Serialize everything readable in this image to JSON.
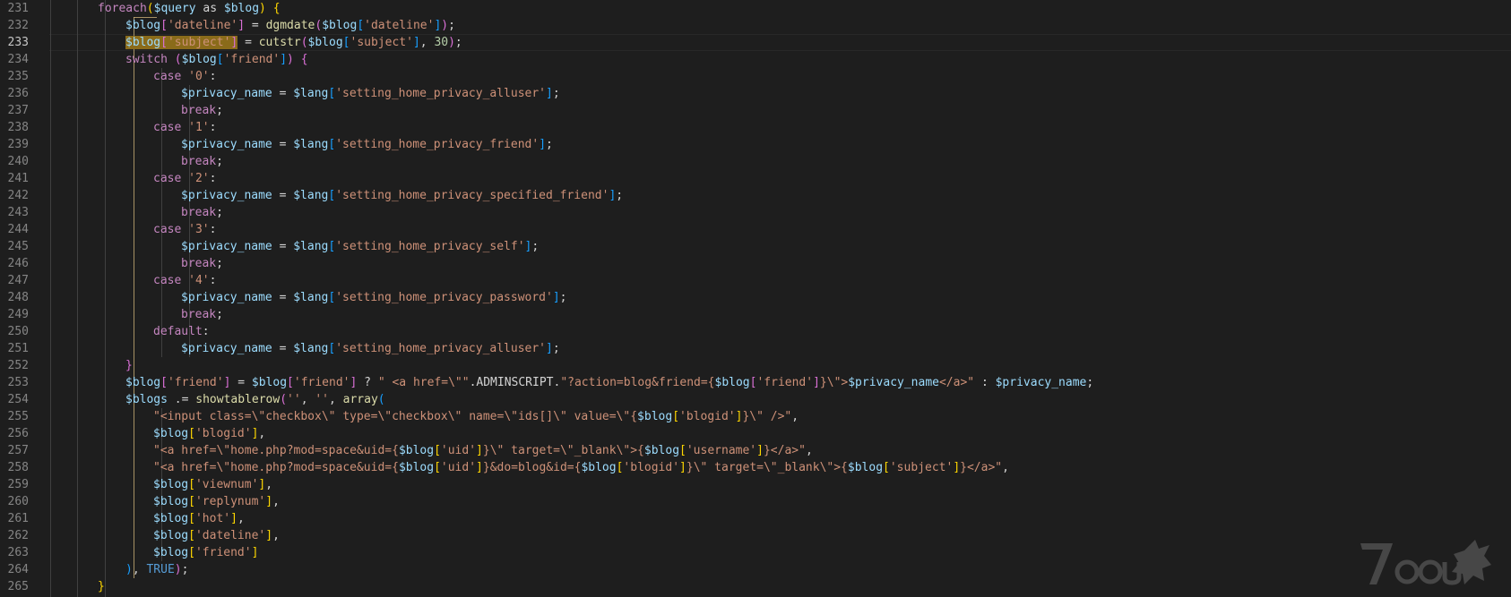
{
  "editor": {
    "current_line": "233",
    "line_numbers": [
      "231",
      "232",
      "233",
      "234",
      "235",
      "236",
      "237",
      "238",
      "239",
      "240",
      "241",
      "242",
      "243",
      "244",
      "245",
      "246",
      "247",
      "248",
      "249",
      "250",
      "251",
      "252",
      "253",
      "254",
      "255",
      "256",
      "257",
      "258",
      "259",
      "260",
      "261",
      "262",
      "263",
      "264",
      "265"
    ]
  },
  "code": [
    [
      [
        "k",
        "foreach"
      ],
      [
        "b1",
        "("
      ],
      [
        "v",
        "$query"
      ],
      [
        "p",
        " as "
      ],
      [
        "v",
        "$blog"
      ],
      [
        "b1",
        ")"
      ],
      [
        "p",
        " "
      ],
      [
        "b1",
        "{"
      ]
    ],
    [
      [
        "v",
        "$blog"
      ],
      [
        "b2",
        "["
      ],
      [
        "s",
        "'dateline'"
      ],
      [
        "b2",
        "]"
      ],
      [
        "p",
        " = "
      ],
      [
        "f",
        "dgmdate"
      ],
      [
        "b2",
        "("
      ],
      [
        "v",
        "$blog"
      ],
      [
        "b3",
        "["
      ],
      [
        "s",
        "'dateline'"
      ],
      [
        "b3",
        "]"
      ],
      [
        "b2",
        ")"
      ],
      [
        "p",
        ";"
      ]
    ],
    [
      [
        "hl:v",
        "$blog"
      ],
      [
        "hl:b2",
        "["
      ],
      [
        "hl:s",
        "'subject'"
      ],
      [
        "hl:b2",
        "]"
      ],
      [
        "p",
        " = "
      ],
      [
        "f",
        "cutstr"
      ],
      [
        "b2",
        "("
      ],
      [
        "v",
        "$blog"
      ],
      [
        "b3",
        "["
      ],
      [
        "s",
        "'subject'"
      ],
      [
        "b3",
        "]"
      ],
      [
        "p",
        ", "
      ],
      [
        "n",
        "30"
      ],
      [
        "b2",
        ")"
      ],
      [
        "p",
        ";"
      ]
    ],
    [
      [
        "k",
        "switch"
      ],
      [
        "p",
        " "
      ],
      [
        "b2",
        "("
      ],
      [
        "v",
        "$blog"
      ],
      [
        "b3",
        "["
      ],
      [
        "s",
        "'friend'"
      ],
      [
        "b3",
        "]"
      ],
      [
        "b2",
        ")"
      ],
      [
        "p",
        " "
      ],
      [
        "b2",
        "{"
      ]
    ],
    [
      [
        "k",
        "case"
      ],
      [
        "p",
        " "
      ],
      [
        "s",
        "'0'"
      ],
      [
        "p",
        ":"
      ]
    ],
    [
      [
        "v",
        "$privacy_name"
      ],
      [
        "p",
        " = "
      ],
      [
        "v",
        "$lang"
      ],
      [
        "b3",
        "["
      ],
      [
        "s",
        "'setting_home_privacy_alluser'"
      ],
      [
        "b3",
        "]"
      ],
      [
        "p",
        ";"
      ]
    ],
    [
      [
        "k",
        "break"
      ],
      [
        "p",
        ";"
      ]
    ],
    [
      [
        "k",
        "case"
      ],
      [
        "p",
        " "
      ],
      [
        "s",
        "'1'"
      ],
      [
        "p",
        ":"
      ]
    ],
    [
      [
        "v",
        "$privacy_name"
      ],
      [
        "p",
        " = "
      ],
      [
        "v",
        "$lang"
      ],
      [
        "b3",
        "["
      ],
      [
        "s",
        "'setting_home_privacy_friend'"
      ],
      [
        "b3",
        "]"
      ],
      [
        "p",
        ";"
      ]
    ],
    [
      [
        "k",
        "break"
      ],
      [
        "p",
        ";"
      ]
    ],
    [
      [
        "k",
        "case"
      ],
      [
        "p",
        " "
      ],
      [
        "s",
        "'2'"
      ],
      [
        "p",
        ":"
      ]
    ],
    [
      [
        "v",
        "$privacy_name"
      ],
      [
        "p",
        " = "
      ],
      [
        "v",
        "$lang"
      ],
      [
        "b3",
        "["
      ],
      [
        "s",
        "'setting_home_privacy_specified_friend'"
      ],
      [
        "b3",
        "]"
      ],
      [
        "p",
        ";"
      ]
    ],
    [
      [
        "k",
        "break"
      ],
      [
        "p",
        ";"
      ]
    ],
    [
      [
        "k",
        "case"
      ],
      [
        "p",
        " "
      ],
      [
        "s",
        "'3'"
      ],
      [
        "p",
        ":"
      ]
    ],
    [
      [
        "v",
        "$privacy_name"
      ],
      [
        "p",
        " = "
      ],
      [
        "v",
        "$lang"
      ],
      [
        "b3",
        "["
      ],
      [
        "s",
        "'setting_home_privacy_self'"
      ],
      [
        "b3",
        "]"
      ],
      [
        "p",
        ";"
      ]
    ],
    [
      [
        "k",
        "break"
      ],
      [
        "p",
        ";"
      ]
    ],
    [
      [
        "k",
        "case"
      ],
      [
        "p",
        " "
      ],
      [
        "s",
        "'4'"
      ],
      [
        "p",
        ":"
      ]
    ],
    [
      [
        "v",
        "$privacy_name"
      ],
      [
        "p",
        " = "
      ],
      [
        "v",
        "$lang"
      ],
      [
        "b3",
        "["
      ],
      [
        "s",
        "'setting_home_privacy_password'"
      ],
      [
        "b3",
        "]"
      ],
      [
        "p",
        ";"
      ]
    ],
    [
      [
        "k",
        "break"
      ],
      [
        "p",
        ";"
      ]
    ],
    [
      [
        "k",
        "default"
      ],
      [
        "p",
        ":"
      ]
    ],
    [
      [
        "v",
        "$privacy_name"
      ],
      [
        "p",
        " = "
      ],
      [
        "v",
        "$lang"
      ],
      [
        "b3",
        "["
      ],
      [
        "s",
        "'setting_home_privacy_alluser'"
      ],
      [
        "b3",
        "]"
      ],
      [
        "p",
        ";"
      ]
    ],
    [
      [
        "b2",
        "}"
      ]
    ],
    [
      [
        "v",
        "$blog"
      ],
      [
        "b2",
        "["
      ],
      [
        "s",
        "'friend'"
      ],
      [
        "b2",
        "]"
      ],
      [
        "p",
        " = "
      ],
      [
        "v",
        "$blog"
      ],
      [
        "b2",
        "["
      ],
      [
        "s",
        "'friend'"
      ],
      [
        "b2",
        "]"
      ],
      [
        "p",
        " ? "
      ],
      [
        "s",
        "\" <a href=\\\"\""
      ],
      [
        "p",
        "."
      ],
      [
        "p",
        "ADMINSCRIPT"
      ],
      [
        "p",
        "."
      ],
      [
        "s",
        "\"?action=blog&friend={"
      ],
      [
        "v",
        "$blog"
      ],
      [
        "b2",
        "["
      ],
      [
        "s",
        "'friend'"
      ],
      [
        "b2",
        "]"
      ],
      [
        "s",
        "}\\\">"
      ],
      [
        "v",
        "$privacy_name"
      ],
      [
        "s",
        "</a>\""
      ],
      [
        "p",
        " : "
      ],
      [
        "v",
        "$privacy_name"
      ],
      [
        "p",
        ";"
      ]
    ],
    [
      [
        "v",
        "$blogs"
      ],
      [
        "p",
        " .= "
      ],
      [
        "f",
        "showtablerow"
      ],
      [
        "b2",
        "("
      ],
      [
        "s",
        "''"
      ],
      [
        "p",
        ", "
      ],
      [
        "s",
        "''"
      ],
      [
        "p",
        ", "
      ],
      [
        "f",
        "array"
      ],
      [
        "b3",
        "("
      ]
    ],
    [
      [
        "s",
        "\"<input class=\\\"checkbox\\\" type=\\\"checkbox\\\" name=\\\"ids[]\\\" value=\\\"{"
      ],
      [
        "v",
        "$blog"
      ],
      [
        "b1",
        "["
      ],
      [
        "s",
        "'blogid'"
      ],
      [
        "b1",
        "]"
      ],
      [
        "s",
        "}\\\" />\""
      ],
      [
        "p",
        ","
      ]
    ],
    [
      [
        "v",
        "$blog"
      ],
      [
        "b1",
        "["
      ],
      [
        "s",
        "'blogid'"
      ],
      [
        "b1",
        "]"
      ],
      [
        "p",
        ","
      ]
    ],
    [
      [
        "s",
        "\"<a href=\\\"home.php?mod=space&uid={"
      ],
      [
        "v",
        "$blog"
      ],
      [
        "b1",
        "["
      ],
      [
        "s",
        "'uid'"
      ],
      [
        "b1",
        "]"
      ],
      [
        "s",
        "}\\\" target=\\\"_blank\\\">{"
      ],
      [
        "v",
        "$blog"
      ],
      [
        "b1",
        "["
      ],
      [
        "s",
        "'username'"
      ],
      [
        "b1",
        "]"
      ],
      [
        "s",
        "}</a>\""
      ],
      [
        "p",
        ","
      ]
    ],
    [
      [
        "s",
        "\"<a href=\\\"home.php?mod=space&uid={"
      ],
      [
        "v",
        "$blog"
      ],
      [
        "b1",
        "["
      ],
      [
        "s",
        "'uid'"
      ],
      [
        "b1",
        "]"
      ],
      [
        "s",
        "}&do=blog&id={"
      ],
      [
        "v",
        "$blog"
      ],
      [
        "b1",
        "["
      ],
      [
        "s",
        "'blogid'"
      ],
      [
        "b1",
        "]"
      ],
      [
        "s",
        "}\\\" target=\\\"_blank\\\">{"
      ],
      [
        "v",
        "$blog"
      ],
      [
        "b1",
        "["
      ],
      [
        "s",
        "'subject'"
      ],
      [
        "b1",
        "]"
      ],
      [
        "s",
        "}</a>\""
      ],
      [
        "p",
        ","
      ]
    ],
    [
      [
        "v",
        "$blog"
      ],
      [
        "b1",
        "["
      ],
      [
        "s",
        "'viewnum'"
      ],
      [
        "b1",
        "]"
      ],
      [
        "p",
        ","
      ]
    ],
    [
      [
        "v",
        "$blog"
      ],
      [
        "b1",
        "["
      ],
      [
        "s",
        "'replynum'"
      ],
      [
        "b1",
        "]"
      ],
      [
        "p",
        ","
      ]
    ],
    [
      [
        "v",
        "$blog"
      ],
      [
        "b1",
        "["
      ],
      [
        "s",
        "'hot'"
      ],
      [
        "b1",
        "]"
      ],
      [
        "p",
        ","
      ]
    ],
    [
      [
        "v",
        "$blog"
      ],
      [
        "b1",
        "["
      ],
      [
        "s",
        "'dateline'"
      ],
      [
        "b1",
        "]"
      ],
      [
        "p",
        ","
      ]
    ],
    [
      [
        "v",
        "$blog"
      ],
      [
        "b1",
        "["
      ],
      [
        "s",
        "'friend'"
      ],
      [
        "b1",
        "]"
      ]
    ],
    [
      [
        "b3",
        ")"
      ],
      [
        "p",
        ", "
      ],
      [
        "c",
        "TRUE"
      ],
      [
        "b2",
        ")"
      ],
      [
        "p",
        ";"
      ]
    ],
    [
      [
        "b1",
        "}"
      ]
    ]
  ],
  "indent": [
    3,
    4,
    4,
    4,
    5,
    6,
    6,
    5,
    6,
    6,
    5,
    6,
    6,
    5,
    6,
    6,
    5,
    6,
    6,
    5,
    6,
    4,
    4,
    4,
    5,
    5,
    5,
    5,
    5,
    5,
    5,
    5,
    5,
    4,
    3
  ],
  "watermark": {
    "text": "7oous"
  }
}
